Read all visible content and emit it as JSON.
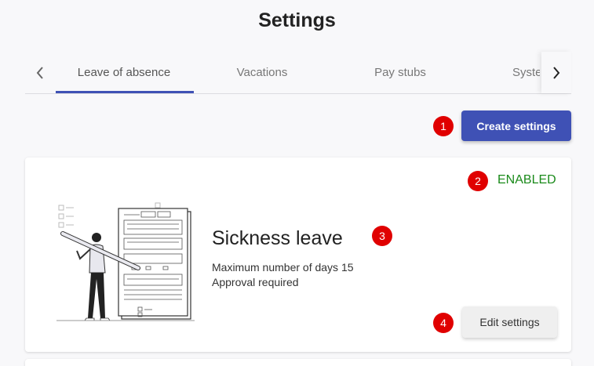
{
  "page": {
    "title": "Settings"
  },
  "tabs": {
    "items": [
      {
        "label": "Leave of absence",
        "active": true
      },
      {
        "label": "Vacations",
        "active": false
      },
      {
        "label": "Pay stubs",
        "active": false
      },
      {
        "label": "System",
        "active": false
      }
    ],
    "prev_icon": "chevron-left-icon",
    "next_icon": "chevron-right-icon",
    "accent": "#3f51b5"
  },
  "toolbar": {
    "create_label": "Create settings"
  },
  "annotations": [
    "1",
    "2",
    "3",
    "4"
  ],
  "card": {
    "status": "ENABLED",
    "status_color": "#1a8a1a",
    "title": "Sickness leave",
    "max_days_label": "Maximum number of days 15",
    "approval": "Approval required",
    "edit_label": "Edit settings",
    "illustration": "person-with-pencil-and-form-illustration"
  }
}
